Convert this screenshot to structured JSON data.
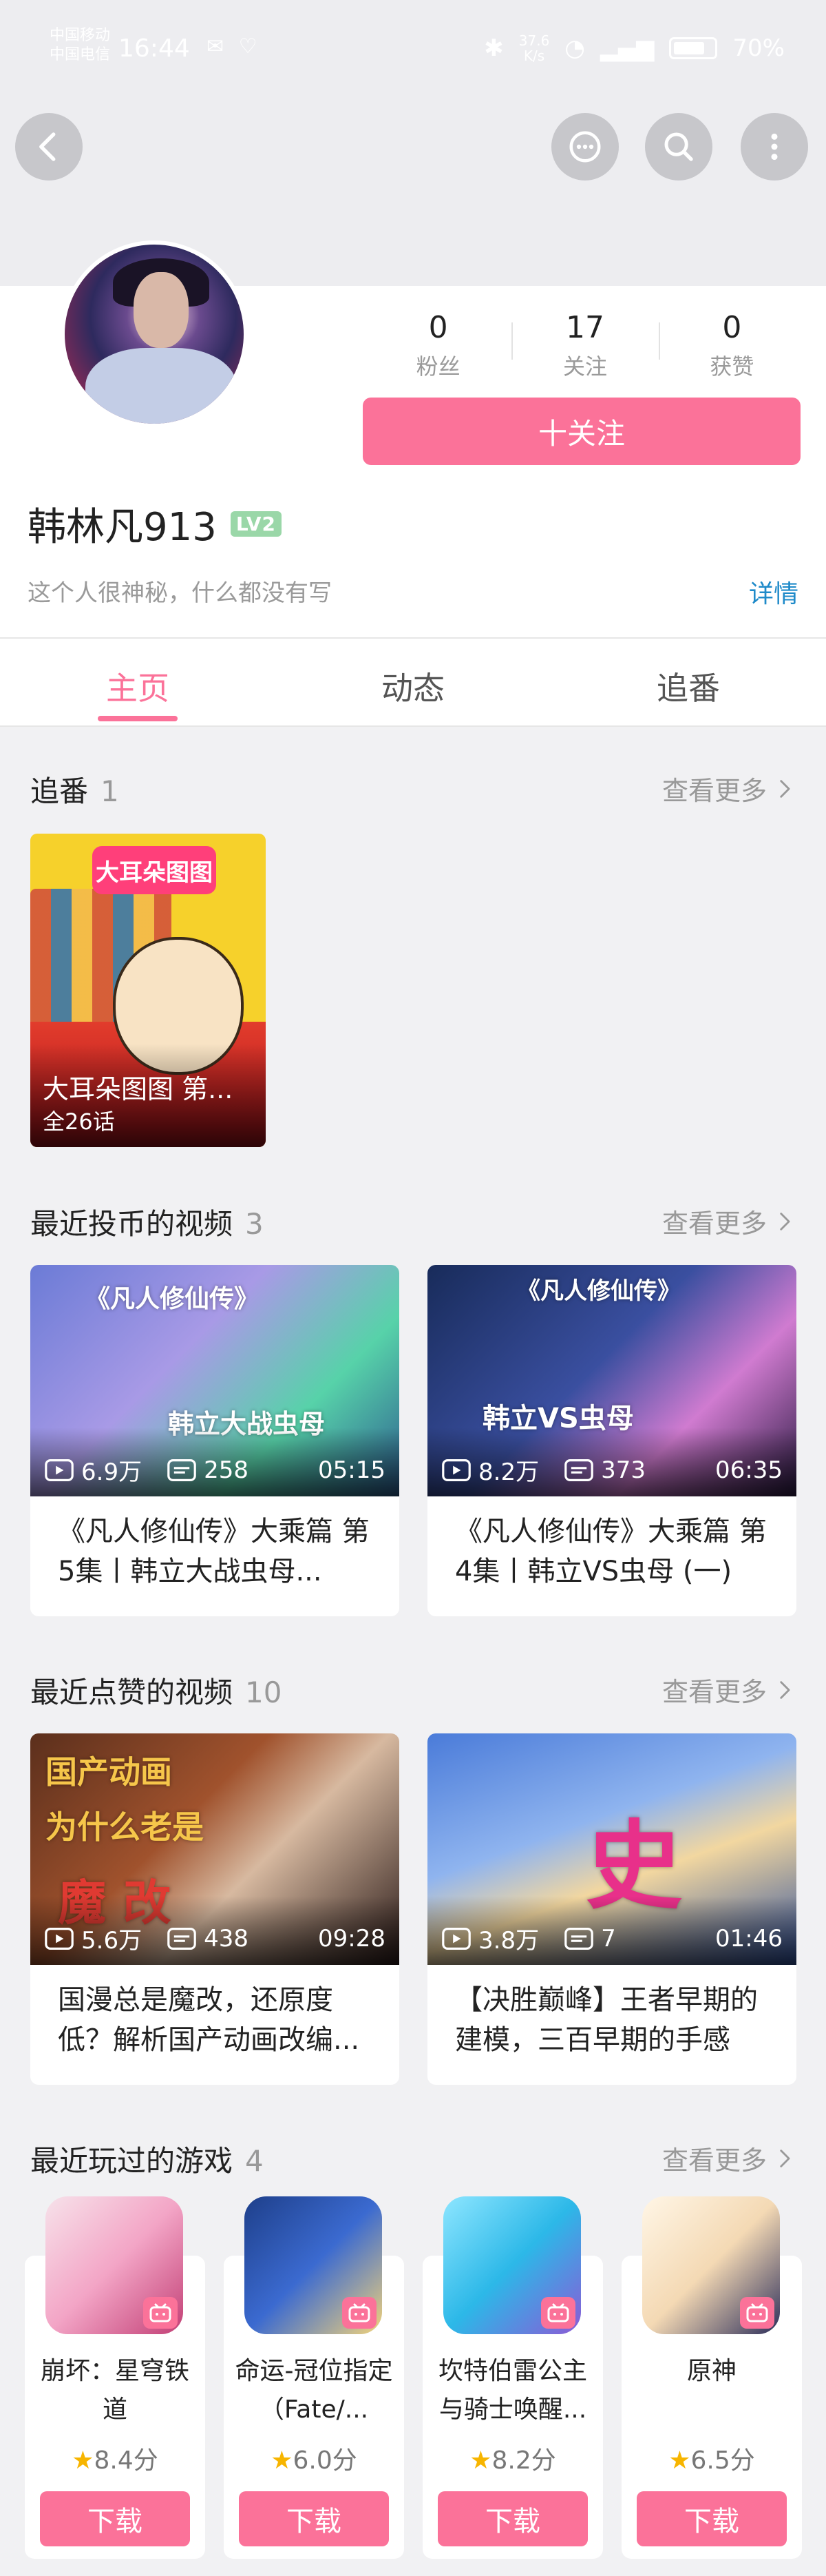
{
  "status_bar": {
    "carrier_1": "中国移动",
    "carrier_2": "中国电信",
    "time": "16:44",
    "speed_value": "37.6",
    "speed_unit": "K/s",
    "battery": "70%"
  },
  "profile": {
    "stats": [
      {
        "num": "0",
        "label": "粉丝"
      },
      {
        "num": "17",
        "label": "关注"
      },
      {
        "num": "0",
        "label": "获赞"
      }
    ],
    "follow_label": "十关注",
    "username": "韩林凡913",
    "level": "LV2",
    "signature": "这个人很神秘，什么都没有写",
    "detail_link": "详情"
  },
  "tabs": [
    {
      "label": "主页"
    },
    {
      "label": "动态"
    },
    {
      "label": "追番"
    }
  ],
  "more_label": "查看更多",
  "bangumi_section": {
    "title": "追番",
    "count": "1",
    "item": {
      "logo": "大耳朵图图",
      "title": "大耳朵图图 第...",
      "eps": "全26话"
    }
  },
  "coin_section": {
    "title": "最近投币的视频",
    "count": "3",
    "videos": [
      {
        "views": "6.9万",
        "danmaku": "258",
        "duration": "05:15",
        "title": "《凡人修仙传》大乘篇 第5集丨韩立大战虫母...",
        "deco_1": "《凡人修仙传》",
        "deco_2": "韩立大战虫母"
      },
      {
        "views": "8.2万",
        "danmaku": "373",
        "duration": "06:35",
        "title": "《凡人修仙传》大乘篇 第4集丨韩立VS虫母 (一)",
        "deco_1": "《凡人修仙传》",
        "deco_2": "韩立VS虫母"
      }
    ]
  },
  "like_section": {
    "title": "最近点赞的视频",
    "count": "10",
    "videos": [
      {
        "views": "5.6万",
        "danmaku": "438",
        "duration": "09:28",
        "title": "国漫总是魔改，还原度低？解析国产动画改编...",
        "deco_1": "国产动画",
        "deco_2": "为什么老是",
        "deco_3": "魔 改"
      },
      {
        "views": "3.8万",
        "danmaku": "7",
        "duration": "01:46",
        "title": "【决胜巅峰】王者早期的建模，三百早期的手感",
        "deco_1": "史"
      }
    ]
  },
  "game_section": {
    "title": "最近玩过的游戏",
    "count": "4",
    "games": [
      {
        "name": "崩坏：星穹铁道",
        "score": "8.4分",
        "button": "下载"
      },
      {
        "name": "命运-冠位指定（Fate/...",
        "score": "6.0分",
        "button": "下载"
      },
      {
        "name": "坎特伯雷公主与骑士唤醒...",
        "score": "8.2分",
        "button": "下载"
      },
      {
        "name": "原神",
        "score": "6.5分",
        "button": "下载"
      }
    ]
  },
  "colors": {
    "accent": "#fb7299",
    "link": "#1e8ac9",
    "star": "#f7b500"
  }
}
